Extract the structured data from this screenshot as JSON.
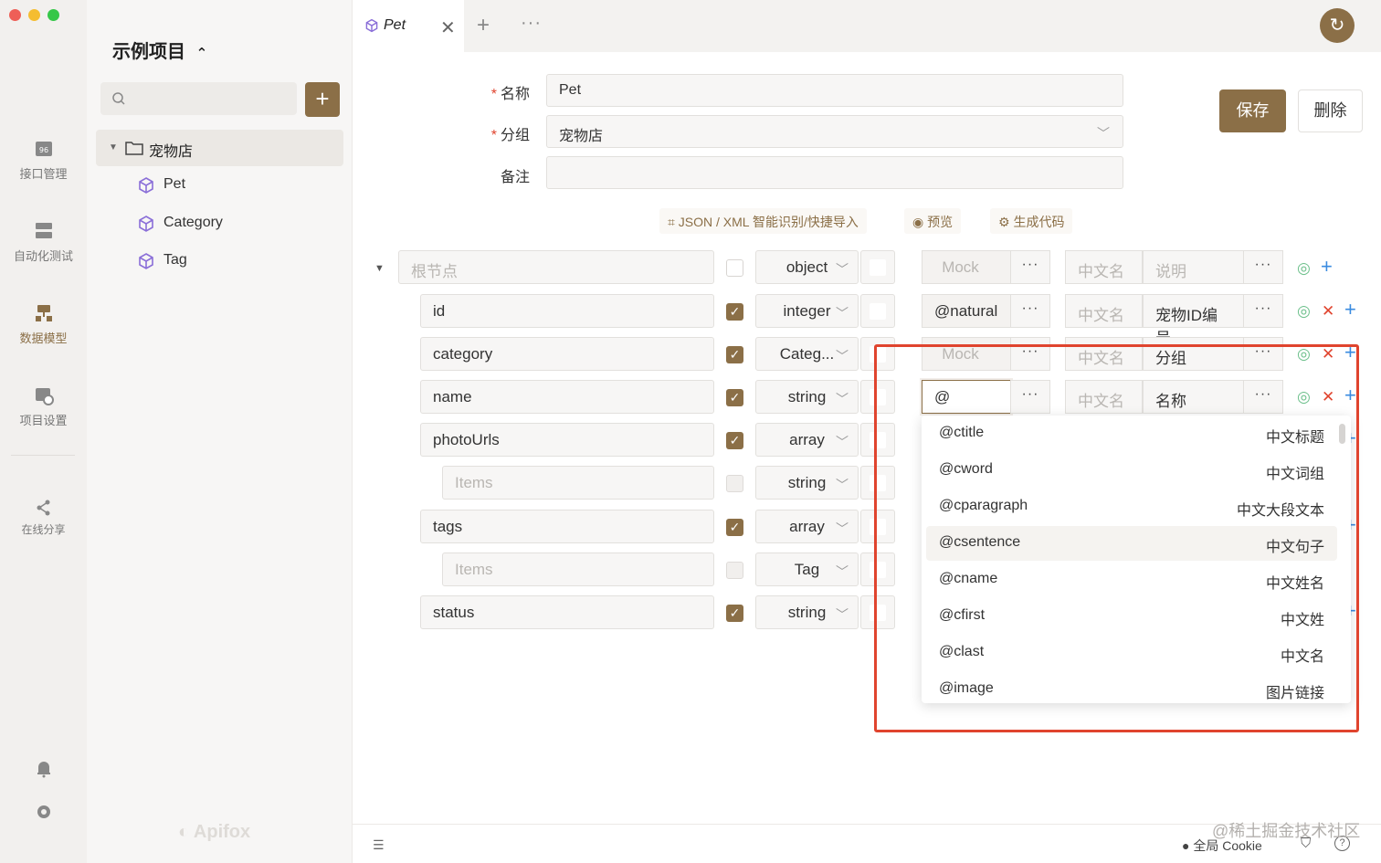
{
  "project": {
    "title": "示例项目"
  },
  "rail": {
    "items": [
      {
        "label": "接口管理"
      },
      {
        "label": "自动化测试"
      },
      {
        "label": "数据模型"
      },
      {
        "label": "项目设置"
      },
      {
        "label": "在线分享"
      }
    ]
  },
  "tree": {
    "folder": "宠物店",
    "items": [
      {
        "label": "Pet"
      },
      {
        "label": "Category"
      },
      {
        "label": "Tag"
      }
    ]
  },
  "branding": {
    "watermark_logo": "Apifox"
  },
  "tabs": {
    "active": "Pet"
  },
  "form": {
    "name_label": "名称",
    "name_value": "Pet",
    "group_label": "分组",
    "group_value": "宠物店",
    "note_label": "备注",
    "note_value": ""
  },
  "buttons": {
    "save": "保存",
    "delete": "删除"
  },
  "actions": {
    "import": "JSON / XML 智能识别/快捷导入",
    "preview": "预览",
    "generate": "生成代码"
  },
  "schema": {
    "root": {
      "name_placeholder": "根节点",
      "type": "object",
      "mock_placeholder": "Mock",
      "cn_placeholder": "中文名",
      "desc_placeholder": "说明"
    },
    "rows": [
      {
        "name": "id",
        "type": "integer",
        "mock": "@natural",
        "cn": "中文名",
        "desc": "宠物ID编号"
      },
      {
        "name": "category",
        "type": "Categ...",
        "mock": "Mock",
        "cn": "中文名",
        "desc": "分组"
      },
      {
        "name": "name",
        "type": "string",
        "mock": "@",
        "cn": "中文名",
        "desc": "名称"
      },
      {
        "name": "photoUrls",
        "type": "array"
      },
      {
        "name": "Items",
        "type": "string"
      },
      {
        "name": "tags",
        "type": "array"
      },
      {
        "name": "Items",
        "type": "Tag"
      },
      {
        "name": "status",
        "type": "string"
      }
    ]
  },
  "dropdown": {
    "options": [
      {
        "key": "@ctitle",
        "desc": "中文标题"
      },
      {
        "key": "@cword",
        "desc": "中文词组"
      },
      {
        "key": "@cparagraph",
        "desc": "中文大段文本"
      },
      {
        "key": "@csentence",
        "desc": "中文句子"
      },
      {
        "key": "@cname",
        "desc": "中文姓名"
      },
      {
        "key": "@cfirst",
        "desc": "中文姓"
      },
      {
        "key": "@clast",
        "desc": "中文名"
      },
      {
        "key": "@image",
        "desc": "图片链接"
      }
    ]
  },
  "footer": {
    "cookie": "全局 Cookie",
    "watermark": "@稀土掘金技术社区"
  },
  "colors": {
    "accent": "#8b6f47",
    "danger": "#e0442e",
    "eye": "#6bbf8a",
    "link": "#3a8be0"
  }
}
